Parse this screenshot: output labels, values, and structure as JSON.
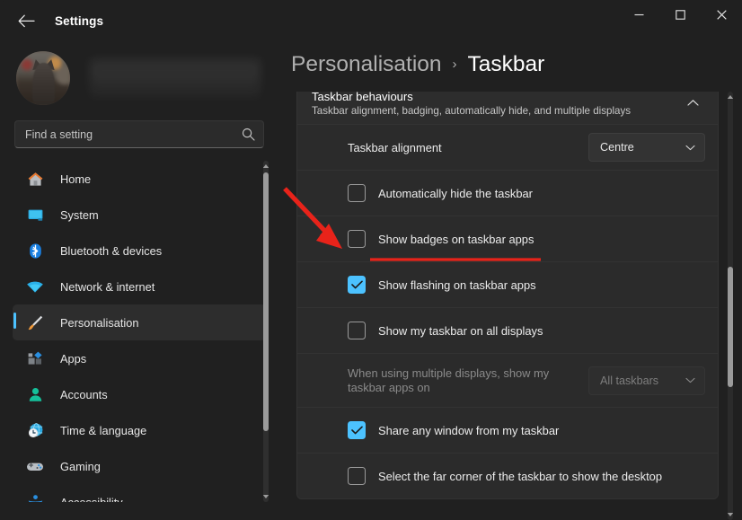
{
  "window": {
    "title": "Settings",
    "back_icon": "back-arrow-icon",
    "minimize_label": "—",
    "maximize_label": "☐",
    "close_label": "✕"
  },
  "sidebar": {
    "account_name_redacted": "",
    "search": {
      "placeholder": "Find a setting",
      "value": "",
      "icon": "search-icon"
    },
    "items": [
      {
        "label": "Home",
        "icon": "home-icon",
        "selected": false
      },
      {
        "label": "System",
        "icon": "monitor-icon",
        "selected": false
      },
      {
        "label": "Bluetooth & devices",
        "icon": "bluetooth-icon",
        "selected": false
      },
      {
        "label": "Network & internet",
        "icon": "wifi-icon",
        "selected": false
      },
      {
        "label": "Personalisation",
        "icon": "paintbrush-icon",
        "selected": true
      },
      {
        "label": "Apps",
        "icon": "apps-icon",
        "selected": false
      },
      {
        "label": "Accounts",
        "icon": "person-icon",
        "selected": false
      },
      {
        "label": "Time & language",
        "icon": "clock-globe-icon",
        "selected": false
      },
      {
        "label": "Gaming",
        "icon": "gamepad-icon",
        "selected": false
      },
      {
        "label": "Accessibility",
        "icon": "accessibility-icon",
        "selected": false
      }
    ]
  },
  "breadcrumb": {
    "parent": "Personalisation",
    "separator": "›",
    "current": "Taskbar"
  },
  "section": {
    "title": "Taskbar behaviours",
    "subtitle": "Taskbar alignment, badging, automatically hide, and multiple displays",
    "collapse_icon": "chevron-up-icon"
  },
  "rows": [
    {
      "type": "dropdown",
      "label": "Taskbar alignment",
      "value": "Centre",
      "disabled": false
    },
    {
      "type": "checkbox",
      "label": "Automatically hide the taskbar",
      "checked": false,
      "disabled": false
    },
    {
      "type": "checkbox",
      "label": "Show badges on taskbar apps",
      "checked": false,
      "disabled": false,
      "highlighted": true
    },
    {
      "type": "checkbox",
      "label": "Show flashing on taskbar apps",
      "checked": true,
      "disabled": false
    },
    {
      "type": "checkbox",
      "label": "Show my taskbar on all displays",
      "checked": false,
      "disabled": false
    },
    {
      "type": "dropdown",
      "label": "When using multiple displays, show my taskbar apps on",
      "value": "All taskbars",
      "disabled": true
    },
    {
      "type": "checkbox",
      "label": "Share any window from my taskbar",
      "checked": true,
      "disabled": false
    },
    {
      "type": "checkbox",
      "label": "Select the far corner of the taskbar to show the desktop",
      "checked": false,
      "disabled": false
    }
  ],
  "annotation": {
    "color": "#e8231a",
    "arrow_name": "red-arrow-pointer",
    "underline_name": "red-underline"
  },
  "colors": {
    "accent": "#4cc2ff",
    "window_bg": "#202020",
    "card_bg": "#2b2b2b",
    "text_primary": "#ffffff",
    "text_secondary": "#c7c7c7"
  }
}
